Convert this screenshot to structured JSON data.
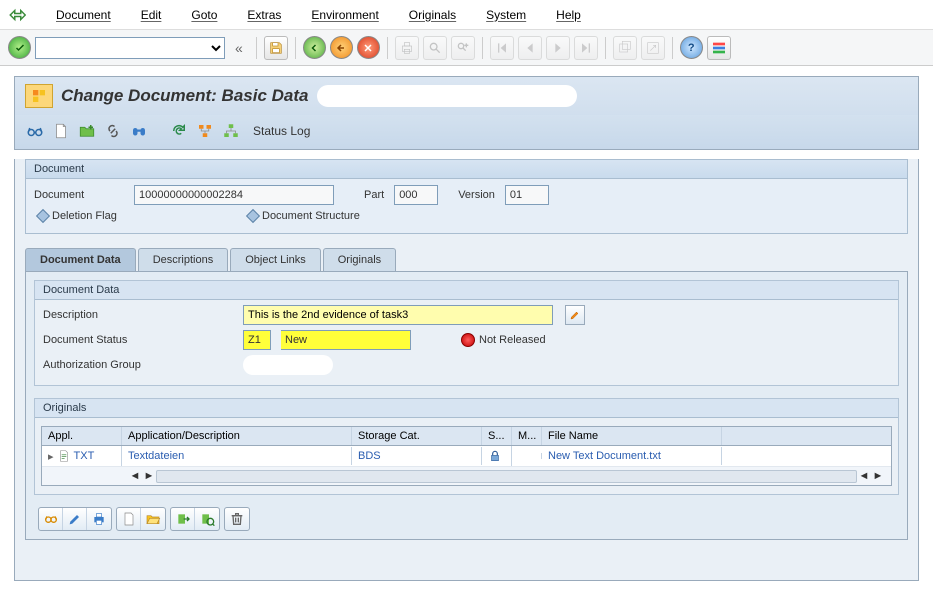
{
  "menu": {
    "document": "Document",
    "edit": "Edit",
    "goto": "Goto",
    "extras": "Extras",
    "environment": "Environment",
    "originals": "Originals",
    "system": "System",
    "help": "Help"
  },
  "title": "Change Document: Basic Data",
  "subtoolbar": {
    "status_log": "Status Log"
  },
  "doc_header": {
    "group_title": "Document",
    "doc_label": "Document",
    "doc_number": "10000000000002284",
    "part_label": "Part",
    "part_value": "000",
    "version_label": "Version",
    "version_value": "01",
    "deletion_flag": "Deletion Flag",
    "doc_structure": "Document Structure"
  },
  "tabs": {
    "doc_data": "Document Data",
    "descriptions": "Descriptions",
    "object_links": "Object Links",
    "originals": "Originals"
  },
  "docdata": {
    "group_title": "Document Data",
    "description_label": "Description",
    "description_value": "This is the 2nd evidence of task3",
    "status_label": "Document Status",
    "status_code": "Z1",
    "status_text": "New",
    "not_released": "Not Released",
    "authgrp_label": "Authorization Group"
  },
  "originals_group": {
    "title": "Originals",
    "col_appl": "Appl.",
    "col_desc": "Application/Description",
    "col_storage": "Storage Cat.",
    "col_s": "S...",
    "col_m": "M...",
    "col_file": "File Name",
    "row": {
      "appl": "TXT",
      "desc": "Textdateien",
      "storage": "BDS",
      "file": "New Text Document.txt"
    }
  }
}
